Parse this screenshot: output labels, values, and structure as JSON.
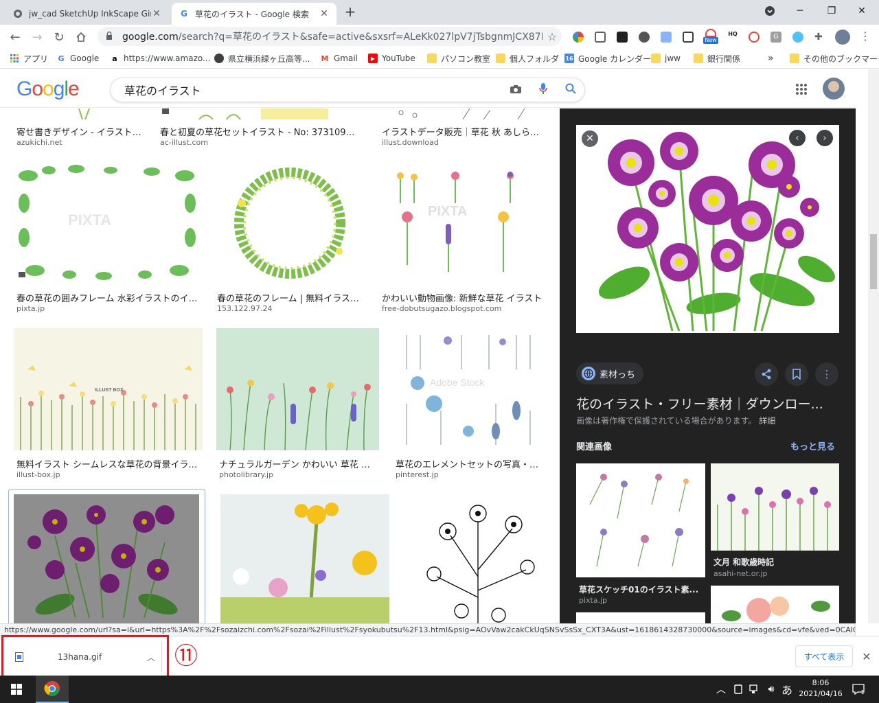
{
  "tabs": [
    {
      "title": "jw_cad SketchUp InkScape Gimp",
      "active": false
    },
    {
      "title": "草花のイラスト - Google 検索",
      "active": true
    }
  ],
  "window": {
    "minimize": "─",
    "restore": "❐",
    "close": "✕"
  },
  "toolbar": {
    "url_host": "google.com",
    "url_path": "/search?q=草花のイラスト&safe=active&sxsrf=ALeKk027lpV7jTsbgnmJCX87E9nph25C...",
    "ext_new_badge": "New",
    "ext_hq_badge": "HQ"
  },
  "bookmarks": [
    {
      "label": "アプリ"
    },
    {
      "label": "Google"
    },
    {
      "label": "https://www.amazo..."
    },
    {
      "label": "県立横浜緑ヶ丘高等..."
    },
    {
      "label": "Gmail"
    },
    {
      "label": "YouTube"
    },
    {
      "label": "パソコン教室"
    },
    {
      "label": "個人フォルダ"
    },
    {
      "label": "Google カレンダー"
    },
    {
      "label": "jww"
    },
    {
      "label": "銀行関係"
    },
    {
      "label": "»"
    },
    {
      "label": "その他のブックマーク"
    }
  ],
  "search": {
    "logo": "Google",
    "query": "草花のイラスト"
  },
  "results": [
    {
      "title": "寄せ書きデザイン - イラスト素...",
      "source": "azukichi.net"
    },
    {
      "title": "春と初夏の草花セットイラスト - No: 373109／無料...",
      "source": "ac-illust.com"
    },
    {
      "title": "イラストデータ販売｜草花 秋 あしらい ...",
      "source": "illust.download"
    },
    {
      "title": "春の草花の囲みフレーム 水彩イラストのイラ...",
      "source": "pixta.jp"
    },
    {
      "title": "春の草花のフレーム | 無料イラスト...",
      "source": "153.122.97.24"
    },
    {
      "title": "かわいい動物画像: 新鮮な草花 イラスト",
      "source": "free-dobutsugazo.blogspot.com"
    },
    {
      "title": "無料イラスト シームレスな草花の背景イラスト",
      "source": "illust-box.jp"
    },
    {
      "title": "ナチュラルガーデン かわいい 草花 イラ...",
      "source": "photolibrary.jp"
    },
    {
      "title": "草花のエレメントセットの写真・イ...",
      "source": "pinterest.jp"
    }
  ],
  "watermarks": {
    "pixta": "PIXTA",
    "illustbox": "ILLUST BOX"
  },
  "panel": {
    "source_chip": "素材っち",
    "title": "花のイラスト・フリー素材｜ダウンロー...",
    "copyright": "画像は著作権で保護されている場合があります。",
    "details": "詳細",
    "related_heading": "関連画像",
    "more": "もっと見る",
    "related": [
      {
        "title": "草花スケッチ01のイラスト素...",
        "source": "pixta.jp"
      },
      {
        "title": "文月 和歌歳時記",
        "source": "asahi-net.or.jp"
      }
    ]
  },
  "status_url": "https://www.google.com/url?sa=i&url=https%3A%2F%2Fsozaizchi.com%2Fsozai%2Fillust%2Fsyokubutsu%2F13.html&psig=AOvVaw2cakCkUqSNSvSsSx_CXT3A&ust=1618614328730000&source=images&cd=vfe&ved=0CAIQjRxqFw...",
  "download": {
    "filename": "13hana.gif",
    "step": "⑪",
    "show_all": "すべて表示"
  },
  "taskbar": {
    "ime": "あ",
    "time": "8:06",
    "date": "2021/04/16",
    "notif": "1"
  },
  "colors": {
    "accent_red": "#e8141e",
    "panel_bg": "#222222",
    "link_blue": "#8ab4f8",
    "flower": "#9b2d9b"
  }
}
